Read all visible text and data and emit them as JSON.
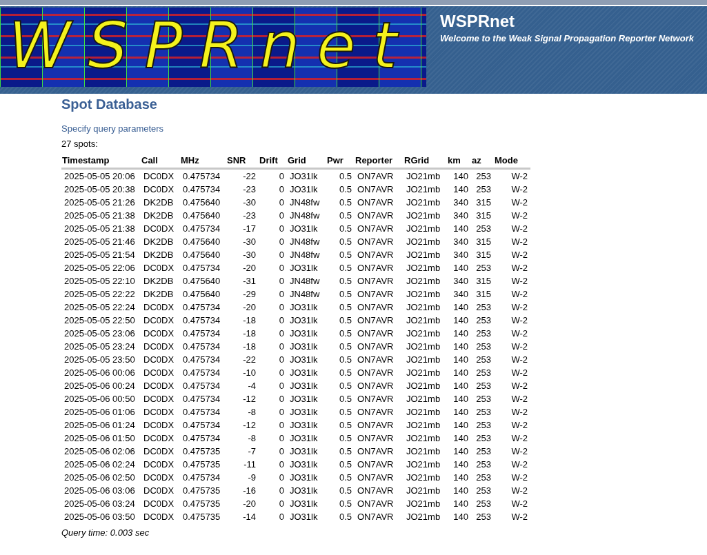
{
  "header": {
    "logo_text": "WSPRnet",
    "title": "WSPRnet",
    "subtitle": "Welcome to the Weak Signal Propagation Reporter Network"
  },
  "page_title": "Spot Database",
  "query_link": "Specify query parameters",
  "spot_count": "27 spots:",
  "table": {
    "columns": [
      "Timestamp",
      "Call",
      "MHz",
      "SNR",
      "Drift",
      "Grid",
      "Pwr",
      "Reporter",
      "RGrid",
      "km",
      "az",
      "Mode"
    ],
    "rows": [
      [
        "2025-05-05 20:06",
        "DC0DX",
        "0.475734",
        "-22",
        "0",
        "JO31lk",
        "0.5",
        "ON7AVR",
        "JO21mb",
        "140",
        "253",
        "W-2"
      ],
      [
        "2025-05-05 20:38",
        "DC0DX",
        "0.475734",
        "-23",
        "0",
        "JO31lk",
        "0.5",
        "ON7AVR",
        "JO21mb",
        "140",
        "253",
        "W-2"
      ],
      [
        "2025-05-05 21:26",
        "DK2DB",
        "0.475640",
        "-30",
        "0",
        "JN48fw",
        "0.5",
        "ON7AVR",
        "JO21mb",
        "340",
        "315",
        "W-2"
      ],
      [
        "2025-05-05 21:38",
        "DK2DB",
        "0.475640",
        "-23",
        "0",
        "JN48fw",
        "0.5",
        "ON7AVR",
        "JO21mb",
        "340",
        "315",
        "W-2"
      ],
      [
        "2025-05-05 21:38",
        "DC0DX",
        "0.475734",
        "-17",
        "0",
        "JO31lk",
        "0.5",
        "ON7AVR",
        "JO21mb",
        "140",
        "253",
        "W-2"
      ],
      [
        "2025-05-05 21:46",
        "DK2DB",
        "0.475640",
        "-30",
        "0",
        "JN48fw",
        "0.5",
        "ON7AVR",
        "JO21mb",
        "340",
        "315",
        "W-2"
      ],
      [
        "2025-05-05 21:54",
        "DK2DB",
        "0.475640",
        "-30",
        "0",
        "JN48fw",
        "0.5",
        "ON7AVR",
        "JO21mb",
        "340",
        "315",
        "W-2"
      ],
      [
        "2025-05-05 22:06",
        "DC0DX",
        "0.475734",
        "-20",
        "0",
        "JO31lk",
        "0.5",
        "ON7AVR",
        "JO21mb",
        "140",
        "253",
        "W-2"
      ],
      [
        "2025-05-05 22:10",
        "DK2DB",
        "0.475640",
        "-31",
        "0",
        "JN48fw",
        "0.5",
        "ON7AVR",
        "JO21mb",
        "340",
        "315",
        "W-2"
      ],
      [
        "2025-05-05 22:22",
        "DK2DB",
        "0.475640",
        "-29",
        "0",
        "JN48fw",
        "0.5",
        "ON7AVR",
        "JO21mb",
        "340",
        "315",
        "W-2"
      ],
      [
        "2025-05-05 22:24",
        "DC0DX",
        "0.475734",
        "-20",
        "0",
        "JO31lk",
        "0.5",
        "ON7AVR",
        "JO21mb",
        "140",
        "253",
        "W-2"
      ],
      [
        "2025-05-05 22:50",
        "DC0DX",
        "0.475734",
        "-18",
        "0",
        "JO31lk",
        "0.5",
        "ON7AVR",
        "JO21mb",
        "140",
        "253",
        "W-2"
      ],
      [
        "2025-05-05 23:06",
        "DC0DX",
        "0.475734",
        "-18",
        "0",
        "JO31lk",
        "0.5",
        "ON7AVR",
        "JO21mb",
        "140",
        "253",
        "W-2"
      ],
      [
        "2025-05-05 23:24",
        "DC0DX",
        "0.475734",
        "-18",
        "0",
        "JO31lk",
        "0.5",
        "ON7AVR",
        "JO21mb",
        "140",
        "253",
        "W-2"
      ],
      [
        "2025-05-05 23:50",
        "DC0DX",
        "0.475734",
        "-22",
        "0",
        "JO31lk",
        "0.5",
        "ON7AVR",
        "JO21mb",
        "140",
        "253",
        "W-2"
      ],
      [
        "2025-05-06 00:06",
        "DC0DX",
        "0.475734",
        "-10",
        "0",
        "JO31lk",
        "0.5",
        "ON7AVR",
        "JO21mb",
        "140",
        "253",
        "W-2"
      ],
      [
        "2025-05-06 00:24",
        "DC0DX",
        "0.475734",
        "-4",
        "0",
        "JO31lk",
        "0.5",
        "ON7AVR",
        "JO21mb",
        "140",
        "253",
        "W-2"
      ],
      [
        "2025-05-06 00:50",
        "DC0DX",
        "0.475734",
        "-12",
        "0",
        "JO31lk",
        "0.5",
        "ON7AVR",
        "JO21mb",
        "140",
        "253",
        "W-2"
      ],
      [
        "2025-05-06 01:06",
        "DC0DX",
        "0.475734",
        "-8",
        "0",
        "JO31lk",
        "0.5",
        "ON7AVR",
        "JO21mb",
        "140",
        "253",
        "W-2"
      ],
      [
        "2025-05-06 01:24",
        "DC0DX",
        "0.475734",
        "-12",
        "0",
        "JO31lk",
        "0.5",
        "ON7AVR",
        "JO21mb",
        "140",
        "253",
        "W-2"
      ],
      [
        "2025-05-06 01:50",
        "DC0DX",
        "0.475734",
        "-8",
        "0",
        "JO31lk",
        "0.5",
        "ON7AVR",
        "JO21mb",
        "140",
        "253",
        "W-2"
      ],
      [
        "2025-05-06 02:06",
        "DC0DX",
        "0.475735",
        "-7",
        "0",
        "JO31lk",
        "0.5",
        "ON7AVR",
        "JO21mb",
        "140",
        "253",
        "W-2"
      ],
      [
        "2025-05-06 02:24",
        "DC0DX",
        "0.475735",
        "-11",
        "0",
        "JO31lk",
        "0.5",
        "ON7AVR",
        "JO21mb",
        "140",
        "253",
        "W-2"
      ],
      [
        "2025-05-06 02:50",
        "DC0DX",
        "0.475734",
        "-9",
        "0",
        "JO31lk",
        "0.5",
        "ON7AVR",
        "JO21mb",
        "140",
        "253",
        "W-2"
      ],
      [
        "2025-05-06 03:06",
        "DC0DX",
        "0.475735",
        "-16",
        "0",
        "JO31lk",
        "0.5",
        "ON7AVR",
        "JO21mb",
        "140",
        "253",
        "W-2"
      ],
      [
        "2025-05-06 03:24",
        "DC0DX",
        "0.475735",
        "-20",
        "0",
        "JO31lk",
        "0.5",
        "ON7AVR",
        "JO21mb",
        "140",
        "253",
        "W-2"
      ],
      [
        "2025-05-06 03:50",
        "DC0DX",
        "0.475735",
        "-14",
        "0",
        "JO31lk",
        "0.5",
        "ON7AVR",
        "JO21mb",
        "140",
        "253",
        "W-2"
      ]
    ]
  },
  "query_time": "Query time: 0.003 sec"
}
